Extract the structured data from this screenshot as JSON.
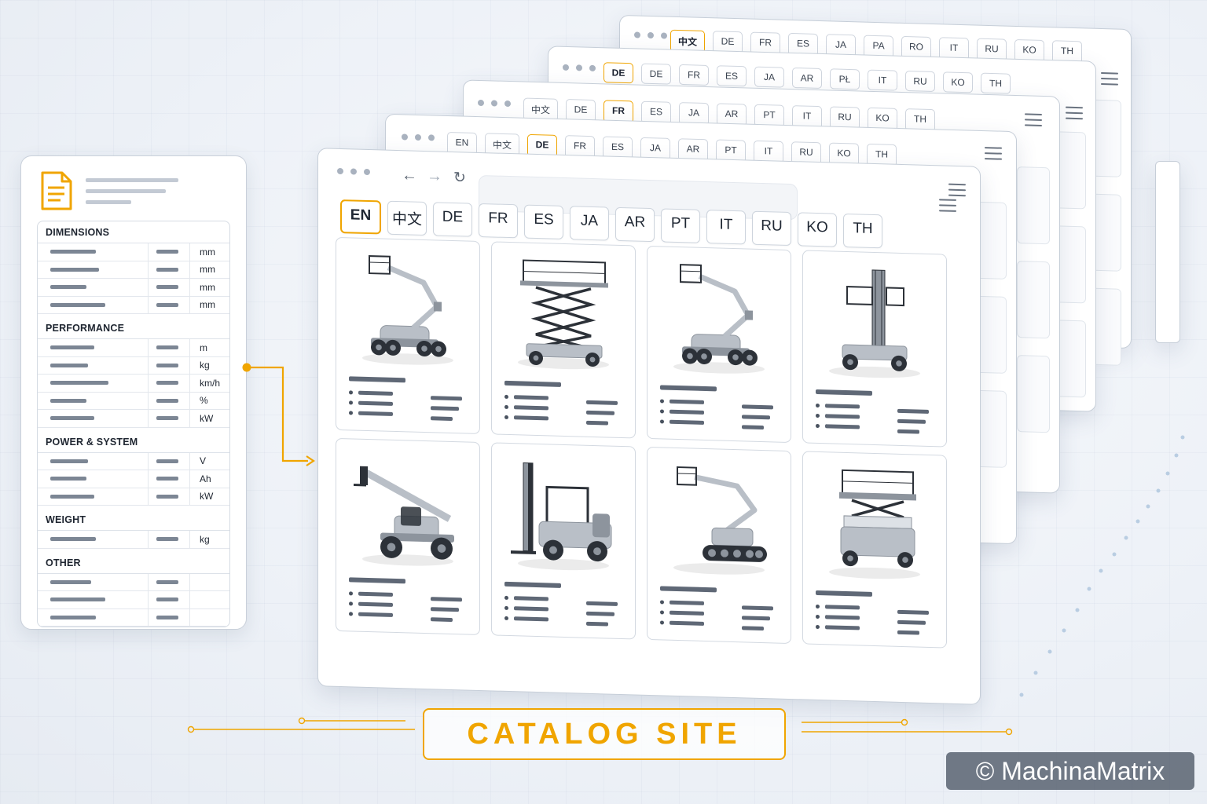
{
  "spec_sheet": {
    "sections": [
      {
        "title": "DIMENSIONS",
        "rows": [
          {
            "unit": "mm"
          },
          {
            "unit": "mm"
          },
          {
            "unit": "mm"
          },
          {
            "unit": "mm"
          }
        ]
      },
      {
        "title": "PERFORMANCE",
        "rows": [
          {
            "unit": "m"
          },
          {
            "unit": "kg"
          },
          {
            "unit": "km/h"
          },
          {
            "unit": "%"
          },
          {
            "unit": "kW"
          }
        ]
      },
      {
        "title": "POWER & SYSTEM",
        "rows": [
          {
            "unit": "V"
          },
          {
            "unit": "Ah"
          },
          {
            "unit": "kW"
          }
        ]
      },
      {
        "title": "WEIGHT",
        "rows": [
          {
            "unit": "kg"
          }
        ]
      },
      {
        "title": "OTHER",
        "rows": [
          {
            "unit": ""
          },
          {
            "unit": ""
          },
          {
            "unit": ""
          }
        ]
      }
    ]
  },
  "front_browser": {
    "languages": [
      "EN",
      "中文",
      "DE",
      "FR",
      "ES",
      "JA",
      "AR",
      "PT",
      "IT",
      "RU",
      "KO",
      "TH"
    ],
    "active_language": "EN",
    "products": [
      {
        "machine": "articulating-boom-lift-icon"
      },
      {
        "machine": "scissor-lift-icon"
      },
      {
        "machine": "articulating-boom-lift-icon"
      },
      {
        "machine": "vertical-mast-lift-icon"
      },
      {
        "machine": "telehandler-icon"
      },
      {
        "machine": "forklift-icon"
      },
      {
        "machine": "tracked-boom-lift-icon"
      },
      {
        "machine": "compact-scissor-lift-icon"
      }
    ]
  },
  "back_browsers": [
    {
      "languages": [
        "EN",
        "中文",
        "DE",
        "FR",
        "ES",
        "JA",
        "AR",
        "PT",
        "IT",
        "RU",
        "KO",
        "TH"
      ],
      "active": "DE"
    },
    {
      "languages": [
        "中文",
        "DE",
        "FR",
        "ES",
        "JA",
        "AR",
        "PT",
        "IT",
        "RU",
        "KO",
        "TH"
      ],
      "active": "FR"
    },
    {
      "languages": [
        "DE",
        "DE",
        "FR",
        "ES",
        "JA",
        "AR",
        "PŁ",
        "IT",
        "RU",
        "KO",
        "TH"
      ],
      "active": "DE"
    },
    {
      "languages": [
        "中文",
        "DE",
        "FR",
        "ES",
        "JA",
        "PA",
        "RO",
        "IT",
        "RU",
        "KO",
        "TH"
      ],
      "active": "中文"
    }
  ],
  "footer": {
    "label": "CATALOG SITE"
  },
  "watermark": {
    "text": "© MachinaMatrix"
  },
  "colors": {
    "accent": "#f0a500",
    "placeholder": "#7c8694",
    "border": "#c6ced8"
  }
}
